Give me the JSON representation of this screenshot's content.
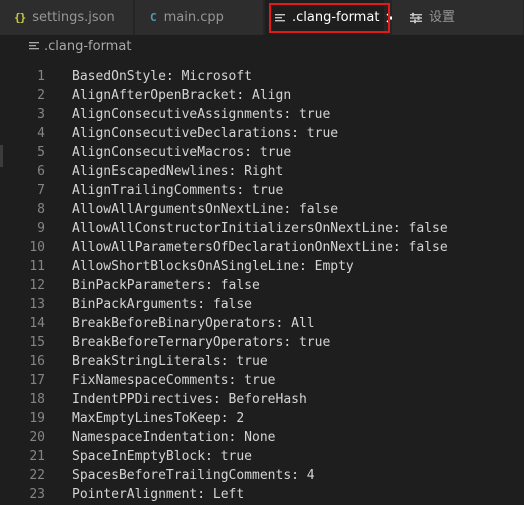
{
  "tabs": [
    {
      "label": "settings.json",
      "icon": "json-braces-icon"
    },
    {
      "label": "main.cpp",
      "icon": "cpp-file-icon"
    },
    {
      "label": ".clang-format",
      "icon": "lines-file-icon",
      "active": true
    },
    {
      "label": "设置",
      "icon": "settings-editor-icon"
    }
  ],
  "icons": {
    "json_glyph": "{}",
    "cpp_glyph": "C"
  },
  "breadcrumb": {
    "label": ".clang-format"
  },
  "colors": {
    "highlight_box": "#e21a1a",
    "editor_bg": "#1e1e1e",
    "line_number": "#858585",
    "code_text": "#d4d4d4"
  },
  "editor": {
    "lines": [
      {
        "n": "1",
        "text": "BasedOnStyle: Microsoft"
      },
      {
        "n": "2",
        "text": "AlignAfterOpenBracket: Align"
      },
      {
        "n": "3",
        "text": "AlignConsecutiveAssignments: true"
      },
      {
        "n": "4",
        "text": "AlignConsecutiveDeclarations: true"
      },
      {
        "n": "5",
        "text": "AlignConsecutiveMacros: true"
      },
      {
        "n": "6",
        "text": "AlignEscapedNewlines: Right"
      },
      {
        "n": "7",
        "text": "AlignTrailingComments: true"
      },
      {
        "n": "8",
        "text": "AllowAllArgumentsOnNextLine: false"
      },
      {
        "n": "9",
        "text": "AllowAllConstructorInitializersOnNextLine: false"
      },
      {
        "n": "10",
        "text": "AllowAllParametersOfDeclarationOnNextLine: false"
      },
      {
        "n": "11",
        "text": "AllowShortBlocksOnASingleLine: Empty"
      },
      {
        "n": "12",
        "text": "BinPackParameters: false"
      },
      {
        "n": "13",
        "text": "BinPackArguments: false"
      },
      {
        "n": "14",
        "text": "BreakBeforeBinaryOperators: All"
      },
      {
        "n": "15",
        "text": "BreakBeforeTernaryOperators: true"
      },
      {
        "n": "16",
        "text": "BreakStringLiterals: true"
      },
      {
        "n": "17",
        "text": "FixNamespaceComments: true"
      },
      {
        "n": "18",
        "text": "IndentPPDirectives: BeforeHash"
      },
      {
        "n": "19",
        "text": "MaxEmptyLinesToKeep: 2"
      },
      {
        "n": "20",
        "text": "NamespaceIndentation: None"
      },
      {
        "n": "21",
        "text": "SpaceInEmptyBlock: true"
      },
      {
        "n": "22",
        "text": "SpacesBeforeTrailingComments: 4"
      },
      {
        "n": "23",
        "text": "PointerAlignment: Left"
      }
    ]
  }
}
